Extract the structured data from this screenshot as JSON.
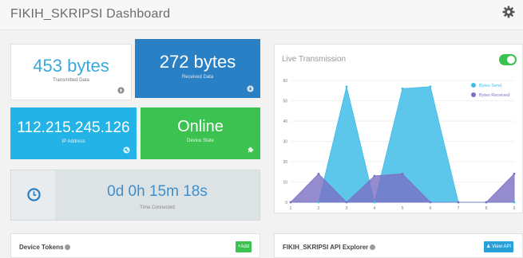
{
  "header": {
    "title": "FIKIH_SKRIPSI Dashboard"
  },
  "tiles": {
    "transmitted": {
      "value": "453 bytes",
      "label": "Transmitted Data"
    },
    "received": {
      "value": "272 bytes",
      "label": "Received Data"
    },
    "ip": {
      "value": "112.215.245.126",
      "label": "IP Address"
    },
    "state": {
      "value": "Online",
      "label": "Device State"
    },
    "time": {
      "value": "0d 0h 15m 18s",
      "label": "Time Connected"
    }
  },
  "live": {
    "title": "Live Transmission",
    "toggle_on": true
  },
  "panels": {
    "tokens": {
      "title": "Device Tokens",
      "button": "+Add"
    },
    "api": {
      "title": "FIKIH_SKRIPSI API Explorer",
      "button": "View API"
    }
  },
  "colors": {
    "sent": "#3fbde8",
    "received": "#7b6fc4",
    "accent_blue": "#2a80c4",
    "green": "#3cc250"
  },
  "chart_data": {
    "type": "area",
    "x": [
      1,
      2,
      3,
      4,
      5,
      6,
      7,
      8,
      9
    ],
    "series": [
      {
        "name": "Bytes Send",
        "values": [
          0,
          0,
          57,
          0,
          56,
          57,
          0,
          0,
          0
        ]
      },
      {
        "name": "Bytes Received",
        "values": [
          0,
          14,
          0,
          13,
          14,
          0,
          0,
          0,
          14
        ]
      }
    ],
    "y_ticks": [
      0,
      10,
      20,
      30,
      40,
      50,
      60
    ],
    "ylim": [
      0,
      62
    ],
    "legend_position": "top-right",
    "grid": true
  }
}
